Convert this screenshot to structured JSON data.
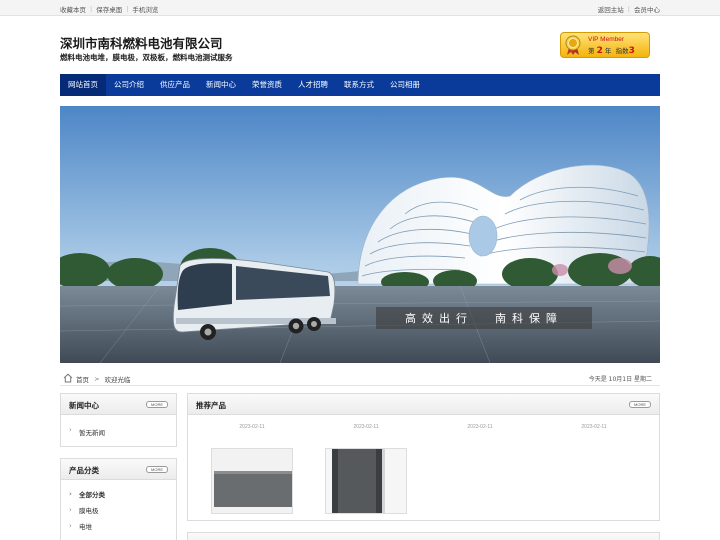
{
  "topbar": {
    "left_links": [
      "收藏本页",
      "保存桌面",
      "手机浏览"
    ],
    "right_links": [
      "返回主站",
      "会员中心"
    ]
  },
  "header": {
    "company_name": "深圳市南科燃料电池有限公司",
    "slogan": "燃料电池电堆，膜电极，双极板，燃料电池测试服务"
  },
  "vip": {
    "label": "VIP Member",
    "prefix": "第",
    "years": "2",
    "unit": "年",
    "level_label": "指数",
    "level": "3"
  },
  "nav": {
    "items": [
      "网站首页",
      "公司介绍",
      "供应产品",
      "新闻中心",
      "荣誉资质",
      "人才招聘",
      "联系方式",
      "公司相册"
    ],
    "active_index": 0
  },
  "banner": {
    "caption_left": "高效出行",
    "caption_right": "南科保障"
  },
  "breadcrumb": {
    "home": "首页",
    "current": "欢迎光临",
    "date": "今天是 10月1日 星期二"
  },
  "news_box": {
    "title": "新闻中心",
    "more": "MORE",
    "items": [
      "暂无新闻"
    ]
  },
  "category_box": {
    "title": "产品分类",
    "more": "MORE",
    "items": [
      "全部分类",
      "膜电极",
      "电堆"
    ]
  },
  "products_box": {
    "title": "推荐产品",
    "more": "MORE",
    "items": [
      {
        "date": "2023-02-11"
      },
      {
        "date": "2023-02-11"
      },
      {
        "date": "2023-02-11"
      },
      {
        "date": "2023-02-11"
      }
    ]
  },
  "colors": {
    "nav_bg": "#0a3b9a",
    "nav_active": "#052a78",
    "vip_gold": "#f4b40c",
    "vip_red": "#cc1111"
  }
}
